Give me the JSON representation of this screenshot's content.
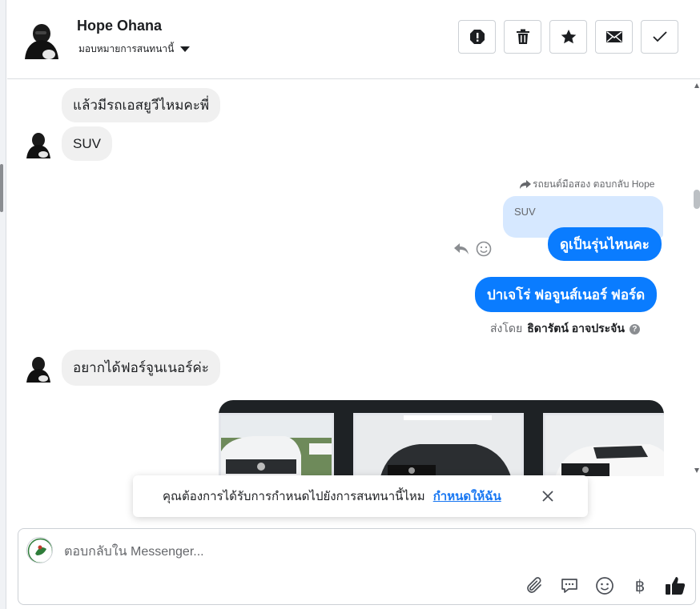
{
  "header": {
    "contact_name": "Hope Ohana",
    "assign_label": "มอบหมายการสนทนานี้",
    "actions": [
      {
        "icon": "exclamation-icon"
      },
      {
        "icon": "trash-icon"
      },
      {
        "icon": "star-icon"
      },
      {
        "icon": "envelope-icon"
      },
      {
        "icon": "check-icon"
      }
    ]
  },
  "messages": {
    "m1": "แล้วมีรถเอสยูวีไหมคะพี่",
    "m2": "SUV",
    "reply_meta": "รถยนต์มือสอง ตอบกลับ Hope",
    "quoted": "SUV",
    "m3": "ดูเป็นรุ่นไหนคะ",
    "m4": "ปาเจโร่ ฟอจูนส์เนอร์ ฟอร์ด",
    "sent_by_prefix": "ส่งโดย",
    "sent_by_name": "ธิดารัตน์ อาจประจัน",
    "m5": "อยากได้ฟอร์จูนเนอร์ค่ะ"
  },
  "toast": {
    "text": "คุณต้องการได้รับการกำหนดไปยังการสนทนานี้ไหม",
    "link": "กำหนดให้ฉัน"
  },
  "composer": {
    "placeholder": "ตอบกลับใน Messenger...",
    "tools": [
      "paperclip-icon",
      "speech-bubble-icon",
      "smiley-icon",
      "baht-icon",
      "thumbs-up-icon"
    ],
    "baht_symbol": "฿"
  },
  "colors": {
    "accent": "#0a7cff",
    "incoming_bubble": "#f0f0f0",
    "quote_bubble": "#d6e8ff",
    "link": "#1877f2"
  }
}
